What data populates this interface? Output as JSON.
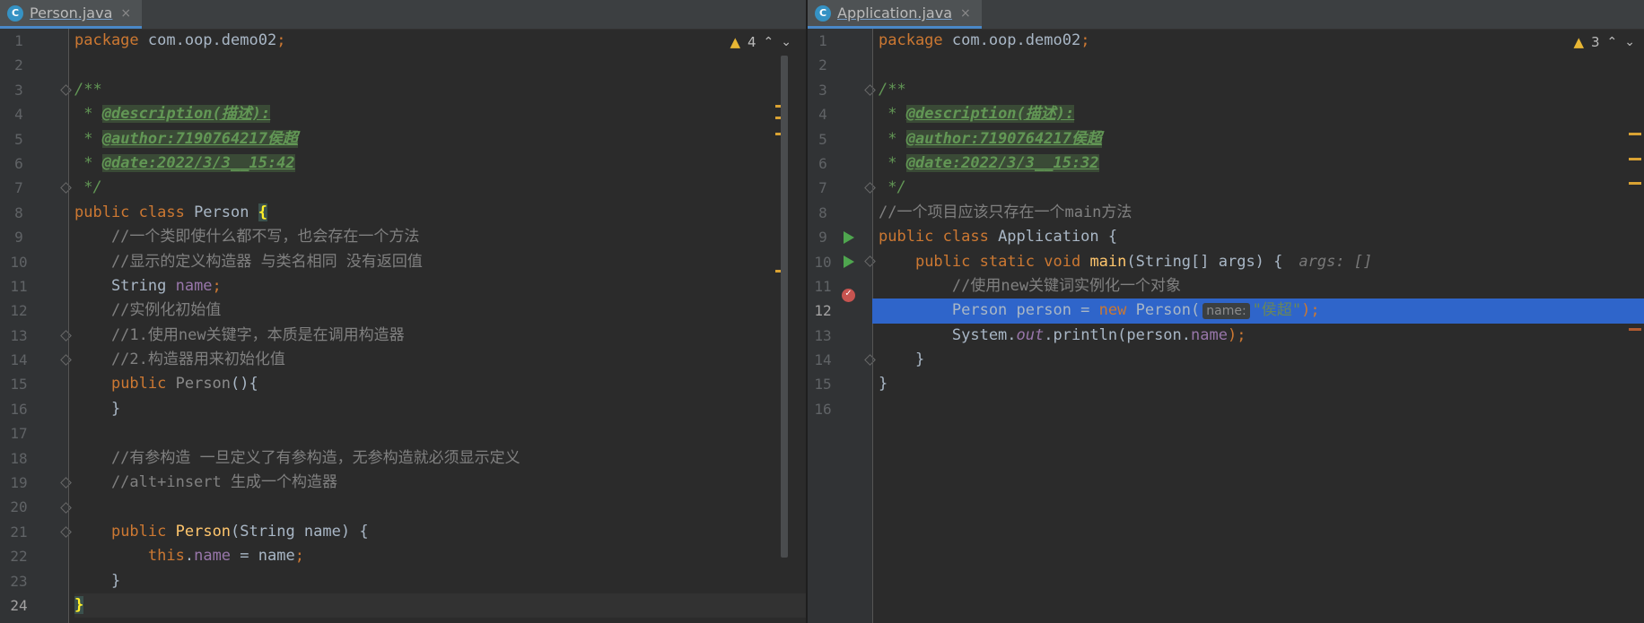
{
  "left": {
    "tab": {
      "icon": "C",
      "title": "Person.java",
      "close": "×"
    },
    "inspection": {
      "icon": "warning-icon",
      "count": "4",
      "prev": "⌃",
      "next": "⌄"
    },
    "active_line": "24"
  },
  "right": {
    "tab": {
      "icon": "C",
      "title": "Application.java",
      "close": "×"
    },
    "inspection": {
      "icon": "warning-icon",
      "count": "3",
      "prev": "⌃",
      "next": "⌄"
    },
    "active_line": "12",
    "hints": {
      "args": "args: []",
      "name_param": "name:"
    }
  },
  "colors": {
    "background": "#2b2b2b",
    "gutter": "#313335",
    "keyword": "#cc7832",
    "comment": "#808080",
    "javadoc": "#629755",
    "field": "#9876aa",
    "method": "#ffc66d",
    "string": "#6a8759",
    "selection": "#2f65ca",
    "tab_accent": "#4a88c7"
  },
  "left_code": {
    "l1_kw": "package",
    "l1_rest": " com.oop.demo02",
    "l1_semi": ";",
    "l3": "/**",
    "l4_star": " * ",
    "l4_tag": "@description(描述):",
    "l5_star": " * ",
    "l5_tag": "@author:7190764217侯超",
    "l6_star": " * ",
    "l6_tag": "@date:2022/3/3__15:42",
    "l7": " */",
    "l8_kw": "public class",
    "l8_name": " Person ",
    "l8_brace": "{",
    "l9": "    //一个类即使什么都不写，也会存在一个方法",
    "l10": "    //显示的定义构造器 与类名相同 没有返回值",
    "l11_type": "    String ",
    "l11_field": "name",
    "l11_semi": ";",
    "l12": "    //实例化初始值",
    "l13": "    //1.使用new关键字，本质是在调用构造器",
    "l14": "    //2.构造器用来初始化值",
    "l15_indent": "    ",
    "l15_kw": "public",
    "l15_name": " Person",
    "l15_rest": "(){",
    "l16": "    }",
    "l18": "    //有参构造 一旦定义了有参构造，无参构造就必须显示定义",
    "l19": "    //alt+insert 生成一个构造器",
    "l21_indent": "    ",
    "l21_kw": "public",
    "l21_sp": " ",
    "l21_name": "Person",
    "l21_rest": "(String name) {",
    "l22_indent": "        ",
    "l22_kw": "this",
    "l22_dot": ".",
    "l22_field": "name",
    "l22_rest": " = name",
    "l22_semi": ";",
    "l23": "    }",
    "l24": "}"
  },
  "right_code": {
    "l1_kw": "package",
    "l1_rest": " com.oop.demo02",
    "l1_semi": ";",
    "l3": "/**",
    "l4_star": " * ",
    "l4_tag": "@description(描述):",
    "l5_star": " * ",
    "l5_tag": "@author:7190764217侯超",
    "l6_star": " * ",
    "l6_tag": "@date:2022/3/3__15:32",
    "l7": " */",
    "l8": "//一个项目应该只存在一个main方法",
    "l9_kw": "public class",
    "l9_name": " Application {",
    "l10_indent": "    ",
    "l10_kw": "public static void",
    "l10_sp": " ",
    "l10_fn": "main",
    "l10_rest": "(String[] args) {",
    "l11": "        //使用new关键词实例化一个对象",
    "l12_a": "        Person person = ",
    "l12_kw": "new",
    "l12_b": " Person(",
    "l12_str": "\"侯超\"",
    "l12_end": ");",
    "l13_a": "        System.",
    "l13_out": "out",
    "l13_b": ".println(person.",
    "l13_field": "name",
    "l13_end": ");",
    "l14": "    }",
    "l15": "}"
  }
}
